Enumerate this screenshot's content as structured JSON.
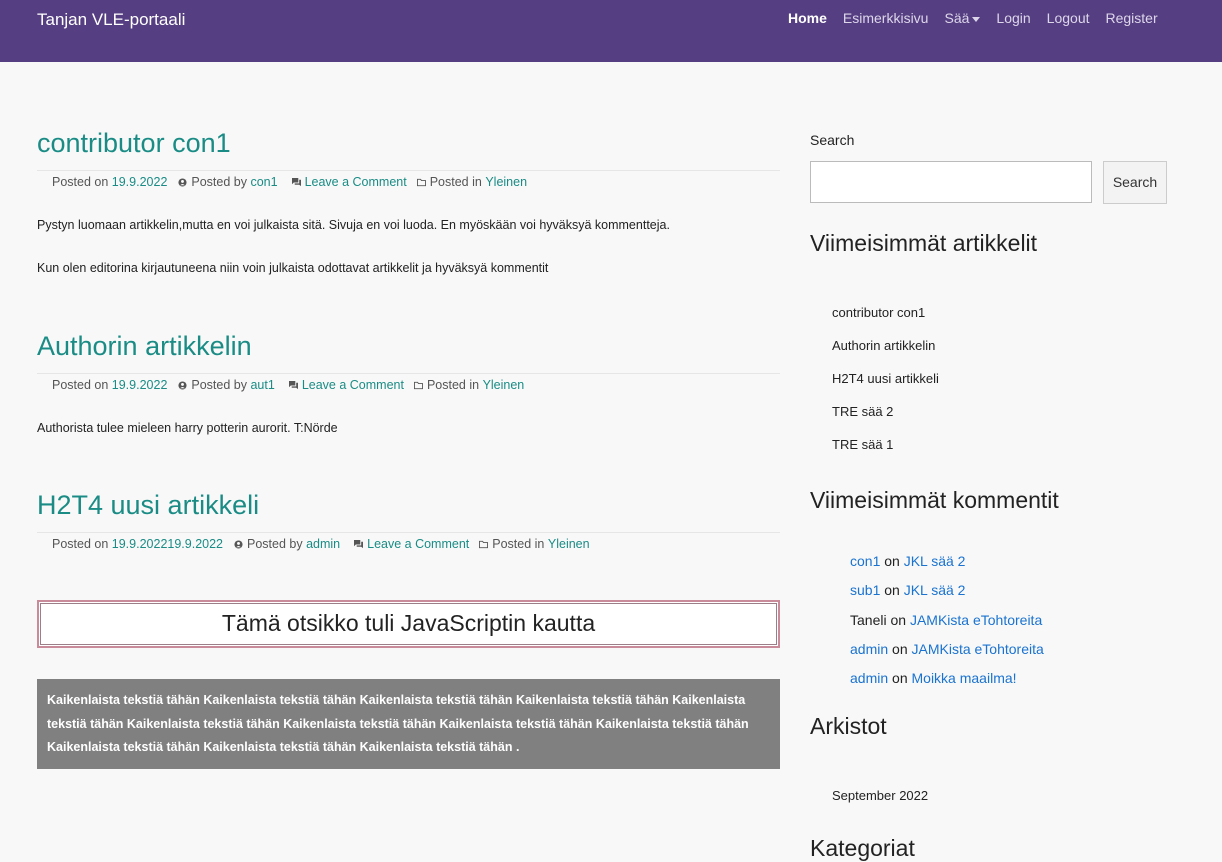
{
  "brand": "Tanjan VLE-portaali",
  "nav": {
    "home": "Home",
    "example": "Esimerkkisivu",
    "weather": "Sää",
    "login": "Login",
    "logout": "Logout",
    "register": "Register"
  },
  "meta_labels": {
    "posted_on": "Posted on",
    "posted_by": "Posted by",
    "leave_comment": "Leave a Comment",
    "posted_in": "Posted in"
  },
  "posts": [
    {
      "title": "contributor con1",
      "date": "19.9.2022",
      "author": "con1",
      "category": "Yleinen",
      "paragraphs": [
        "Pystyn luomaan artikkelin,mutta en voi julkaista sitä. Sivuja en voi luoda. En myöskään voi hyväksyä kommentteja.",
        "Kun olen editorina kirjautuneena niin voin julkaista odottavat artikkelit ja hyväksyä kommentit"
      ]
    },
    {
      "title": "Authorin artikkelin",
      "date": "19.9.2022",
      "author": "aut1",
      "category": "Yleinen",
      "paragraphs": [
        "Authorista tulee mieleen harry potterin aurorit. T:Nörde"
      ]
    },
    {
      "title": "H2T4 uusi artikkeli",
      "date": "19.9.202219.9.2022",
      "author": "admin",
      "category": "Yleinen",
      "paragraphs": []
    }
  ],
  "js_heading": "Tämä otsikko tuli JavaScriptin kautta",
  "grey_text": "Kaikenlaista tekstiä tähän Kaikenlaista tekstiä tähän Kaikenlaista tekstiä tähän Kaikenlaista tekstiä tähän Kaikenlaista tekstiä tähän Kaikenlaista tekstiä tähän Kaikenlaista tekstiä tähän Kaikenlaista tekstiä tähän Kaikenlaista tekstiä tähän Kaikenlaista tekstiä tähän Kaikenlaista tekstiä tähän Kaikenlaista tekstiä tähän .",
  "sidebar": {
    "search_label": "Search",
    "search_button": "Search",
    "recent_posts_title": "Viimeisimmät artikkelit",
    "recent_posts": [
      "contributor con1",
      "Authorin artikkelin",
      "H2T4 uusi artikkeli",
      "TRE sää 2",
      "TRE sää 1"
    ],
    "recent_comments_title": "Viimeisimmät kommentit",
    "on_word": "on",
    "recent_comments": [
      {
        "author": "con1",
        "author_link": true,
        "post": "JKL sää 2"
      },
      {
        "author": "sub1",
        "author_link": true,
        "post": "JKL sää 2"
      },
      {
        "author": "Taneli",
        "author_link": false,
        "post": "JAMKista eTohtoreita"
      },
      {
        "author": "admin",
        "author_link": true,
        "post": "JAMKista eTohtoreita"
      },
      {
        "author": "admin",
        "author_link": true,
        "post": "Moikka maailma!"
      }
    ],
    "archives_title": "Arkistot",
    "archives": [
      "September 2022"
    ],
    "categories_title": "Kategoriat"
  },
  "colors": {
    "navbar": "#553f82",
    "accent": "#1a8c85",
    "comment_link": "#1a73d0",
    "grey_box": "#808080"
  }
}
